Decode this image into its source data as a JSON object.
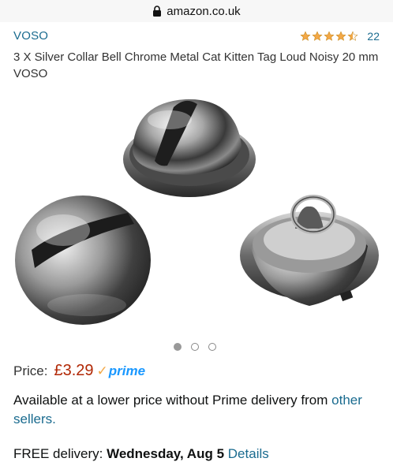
{
  "browser": {
    "url": "amazon.co.uk"
  },
  "product": {
    "brand": "VOSO",
    "rating": {
      "stars": 4.5,
      "max": 5,
      "count": "22"
    },
    "title": "3 X Silver Collar Bell Chrome Metal Cat Kitten Tag Loud Noisy 20 mm VOSO",
    "image_carousel": {
      "total": 3,
      "active": 1
    }
  },
  "price": {
    "label": "Price:",
    "value": "£3.29",
    "prime_check": "✓",
    "prime": "prime"
  },
  "availability": {
    "text": "Available at a lower price without Prime delivery from ",
    "link": "other sellers."
  },
  "delivery": {
    "prefix": "FREE delivery: ",
    "date": "Wednesday, Aug 5",
    "link": "Details"
  },
  "colors": {
    "link": "#1a6b8f",
    "price": "#b12704",
    "prime": "#1a98ff",
    "star": "#f3a847"
  }
}
